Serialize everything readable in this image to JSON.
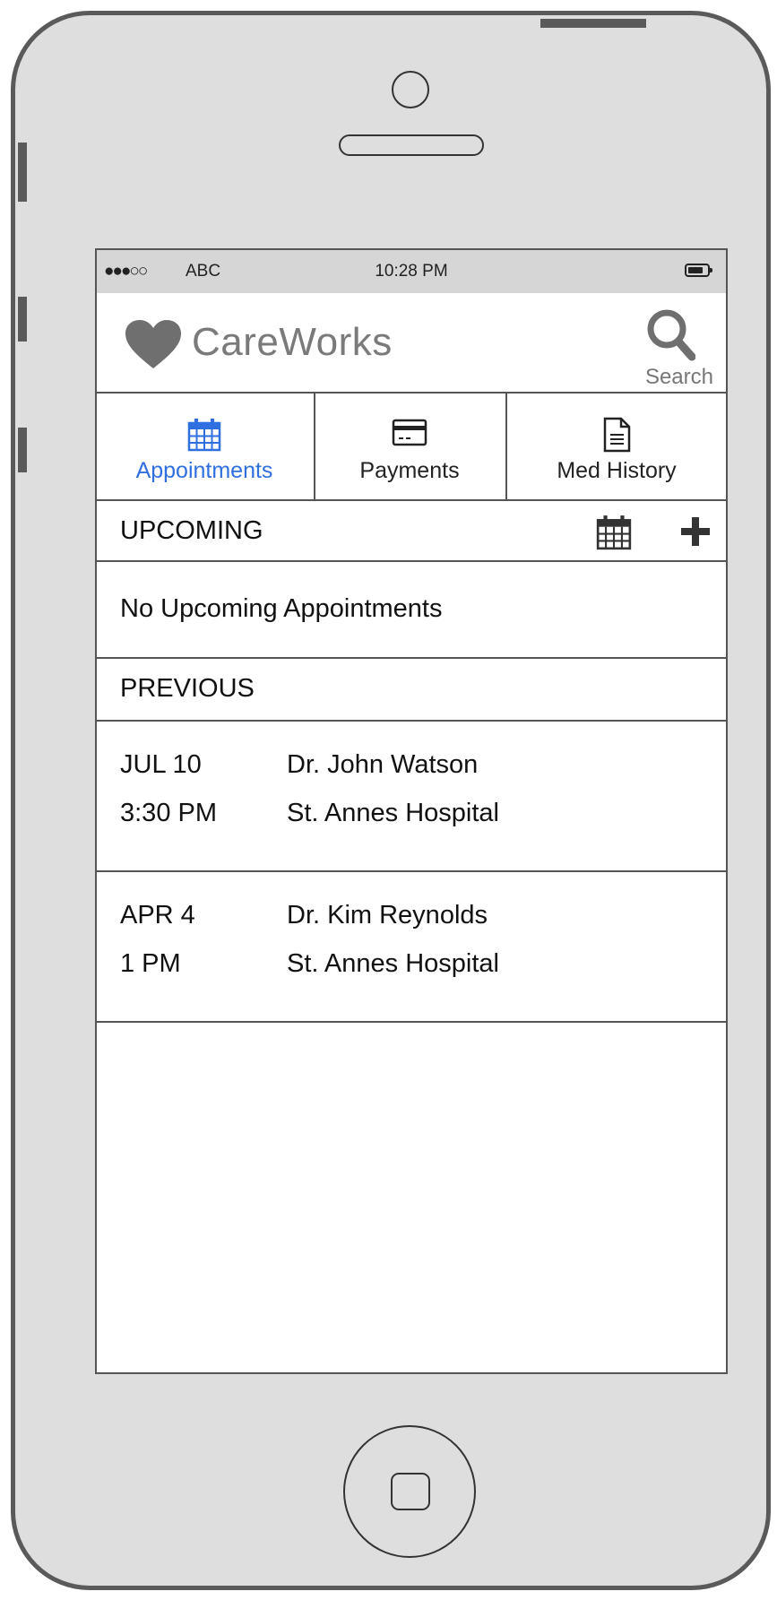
{
  "status_bar": {
    "signal": "●●●○○",
    "carrier": "ABC",
    "time": "10:28 PM",
    "battery_icon": "battery-icon"
  },
  "header": {
    "logo_icon": "heart-icon",
    "app_name": "CareWorks",
    "search_label": "Search"
  },
  "tabs": [
    {
      "label": "Appointments",
      "icon": "calendar-icon",
      "active": true
    },
    {
      "label": "Payments",
      "icon": "credit-card-icon",
      "active": false
    },
    {
      "label": "Med History",
      "icon": "document-icon",
      "active": false
    }
  ],
  "upcoming": {
    "title": "UPCOMING",
    "empty_text": "No Upcoming Appointments"
  },
  "previous": {
    "title": "PREVIOUS",
    "appointments": [
      {
        "date": "JUL 10",
        "time": "3:30 PM",
        "doctor": "Dr. John Watson",
        "location": "St. Annes Hospital"
      },
      {
        "date": "APR 4",
        "time": "1 PM",
        "doctor": "Dr. Kim Reynolds",
        "location": "St. Annes Hospital"
      }
    ]
  },
  "colors": {
    "accent": "#2f6fe0",
    "frame": "#dedede",
    "status_bar": "#d6d6d6",
    "logo": "#7a7a7a"
  }
}
